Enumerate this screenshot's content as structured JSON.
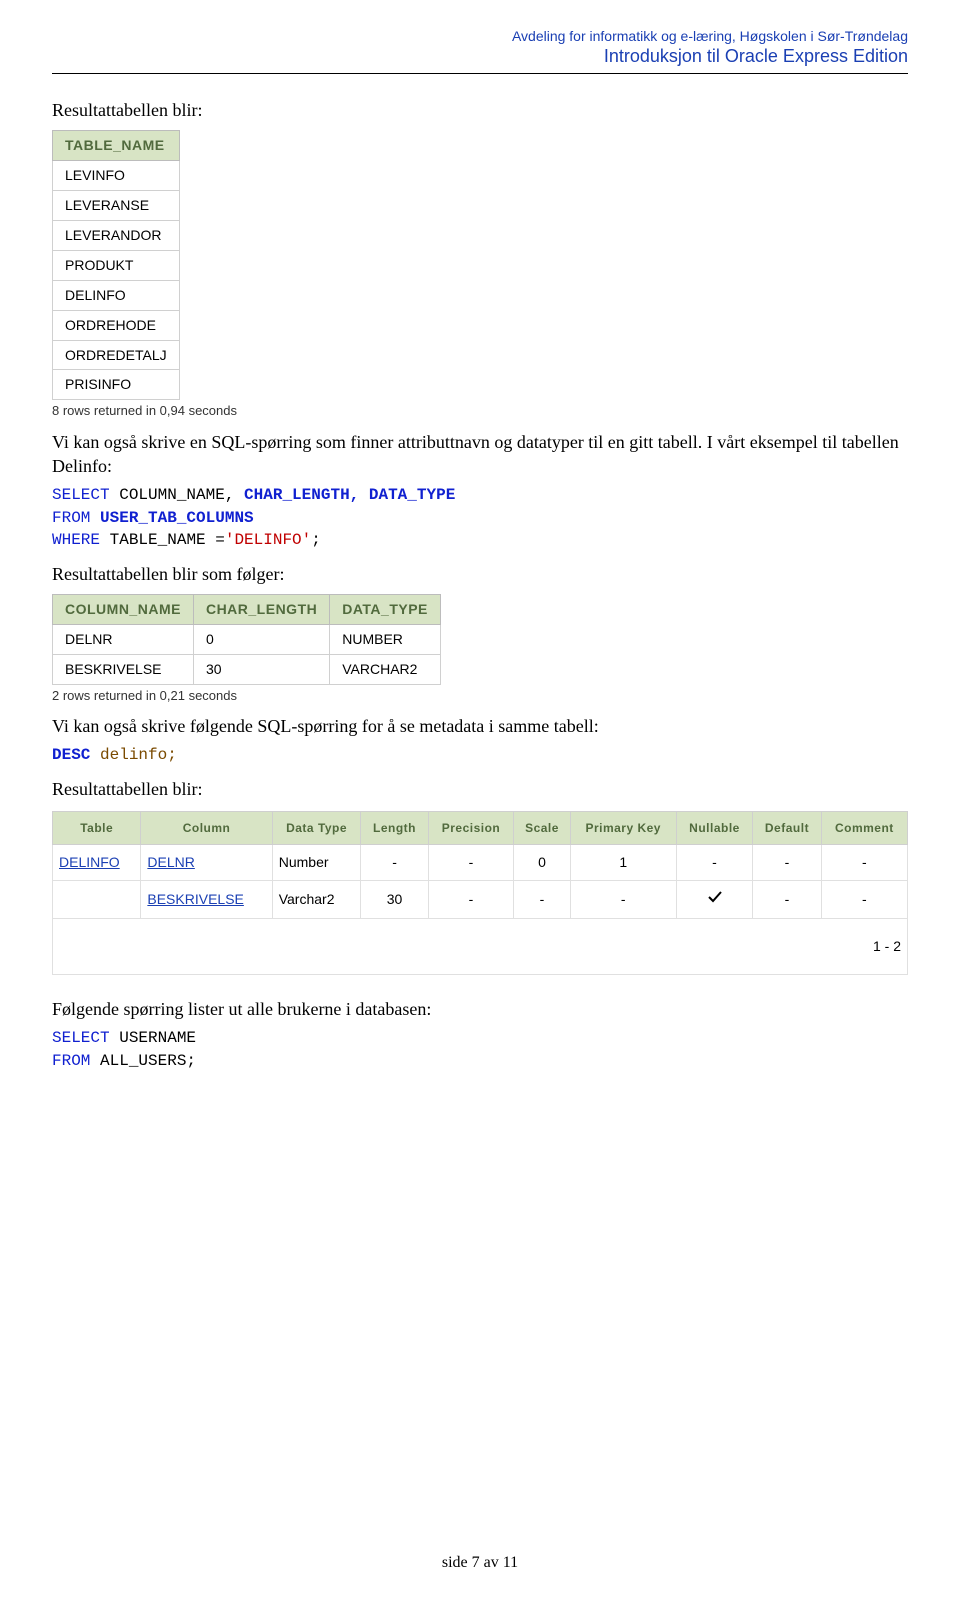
{
  "header": {
    "line1": "Avdeling for informatikk og e-læring, Høgskolen i Sør-Trøndelag",
    "line2": "Introduksjon til Oracle Express Edition"
  },
  "section1": {
    "title": "Resultattabellen blir:",
    "table_header": "TABLE_NAME",
    "rows": [
      "LEVINFO",
      "LEVERANSE",
      "LEVERANDOR",
      "PRODUKT",
      "DELINFO",
      "ORDREHODE",
      "ORDREDETALJ",
      "PRISINFO"
    ],
    "footnote": "8 rows returned in 0,94 seconds"
  },
  "para1": "Vi kan også skrive en SQL-spørring som finner attributtnavn og datatyper til en gitt tabell. I vårt eksempel til tabellen Delinfo:",
  "sql1": {
    "select": "SELECT",
    "cols": "COLUMN_NAME,",
    "bold1": "CHAR_LENGTH,",
    "bold2": "DATA_TYPE",
    "from": "FROM",
    "from_obj": "USER_TAB_COLUMNS",
    "where": "WHERE",
    "where_rest": "TABLE_NAME =",
    "literal": "'DELINFO'",
    "semi": ";"
  },
  "para2": "Resultattabellen blir som følger:",
  "table2": {
    "headers": [
      "COLUMN_NAME",
      "CHAR_LENGTH",
      "DATA_TYPE"
    ],
    "rows": [
      {
        "c1": "DELNR",
        "c2": "0",
        "c3": "NUMBER"
      },
      {
        "c1": "BESKRIVELSE",
        "c2": "30",
        "c3": "VARCHAR2"
      }
    ],
    "footnote": "2 rows returned in 0,21 seconds"
  },
  "para3": "Vi kan også skrive følgende SQL-spørring for å se metadata i samme tabell:",
  "sql2": {
    "desc": "DESC",
    "arg": "delinfo;"
  },
  "para4": "Resultattabellen blir:",
  "table3": {
    "headers": [
      "Table",
      "Column",
      "Data Type",
      "Length",
      "Precision",
      "Scale",
      "Primary Key",
      "Nullable",
      "Default",
      "Comment"
    ],
    "rows": [
      {
        "table": "DELINFO",
        "column": "DELNR",
        "dtype": "Number",
        "len": "-",
        "prec": "-",
        "scale": "0",
        "pk": "1",
        "nullable": "-",
        "def": "-",
        "comment": "-",
        "table_link": true,
        "column_link": true,
        "nullable_check": false
      },
      {
        "table": "",
        "column": "BESKRIVELSE",
        "dtype": "Varchar2",
        "len": "30",
        "prec": "-",
        "scale": "-",
        "pk": "-",
        "nullable": "",
        "def": "-",
        "comment": "-",
        "table_link": false,
        "column_link": true,
        "nullable_check": true
      }
    ],
    "summary": "1 - 2"
  },
  "para5": "Følgende spørring lister ut alle brukerne i databasen:",
  "sql3": {
    "select": "SELECT",
    "col": "USERNAME",
    "from": "FROM",
    "obj": "ALL_USERS;"
  },
  "footer": "side 7 av 11",
  "chart_data": {
    "type": "table",
    "tables": [
      {
        "title": "TABLE_NAME",
        "columns": [
          "TABLE_NAME"
        ],
        "rows": [
          [
            "LEVINFO"
          ],
          [
            "LEVERANSE"
          ],
          [
            "LEVERANDOR"
          ],
          [
            "PRODUKT"
          ],
          [
            "DELINFO"
          ],
          [
            "ORDREHODE"
          ],
          [
            "ORDREDETALJ"
          ],
          [
            "PRISINFO"
          ]
        ]
      },
      {
        "title": "USER_TAB_COLUMNS for DELINFO",
        "columns": [
          "COLUMN_NAME",
          "CHAR_LENGTH",
          "DATA_TYPE"
        ],
        "rows": [
          [
            "DELNR",
            "0",
            "NUMBER"
          ],
          [
            "BESKRIVELSE",
            "30",
            "VARCHAR2"
          ]
        ]
      },
      {
        "title": "DESC delinfo",
        "columns": [
          "Table",
          "Column",
          "Data Type",
          "Length",
          "Precision",
          "Scale",
          "Primary Key",
          "Nullable",
          "Default",
          "Comment"
        ],
        "rows": [
          [
            "DELINFO",
            "DELNR",
            "Number",
            "-",
            "-",
            "0",
            "1",
            "-",
            "-",
            "-"
          ],
          [
            "",
            "BESKRIVELSE",
            "Varchar2",
            "30",
            "-",
            "-",
            "-",
            "✓",
            "-",
            "-"
          ]
        ]
      }
    ]
  }
}
